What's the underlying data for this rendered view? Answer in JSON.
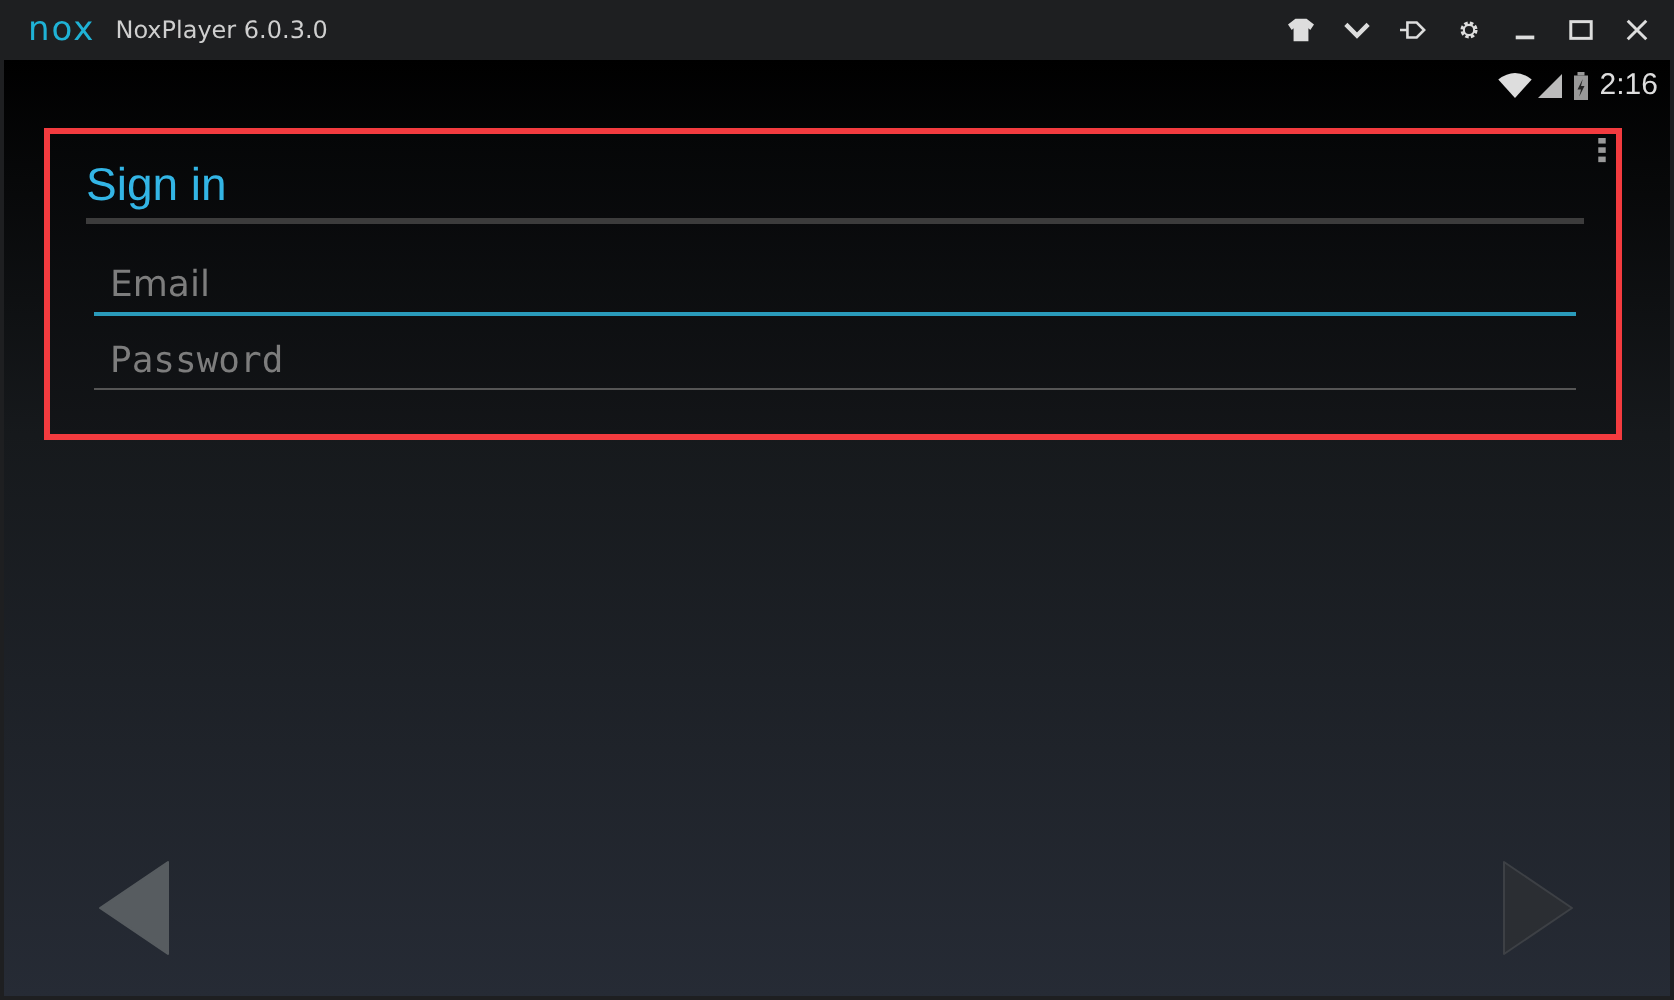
{
  "window": {
    "logo": "nox",
    "title": "NoxPlayer 6.0.3.0"
  },
  "status_bar": {
    "time": "2:16"
  },
  "dialog": {
    "title": "Sign in",
    "fields": [
      {
        "placeholder": "Email",
        "focused": true
      },
      {
        "placeholder": "Password",
        "focused": false
      }
    ]
  },
  "navigation": {
    "back": {
      "disabled": false
    },
    "next": {
      "disabled": true
    }
  }
}
